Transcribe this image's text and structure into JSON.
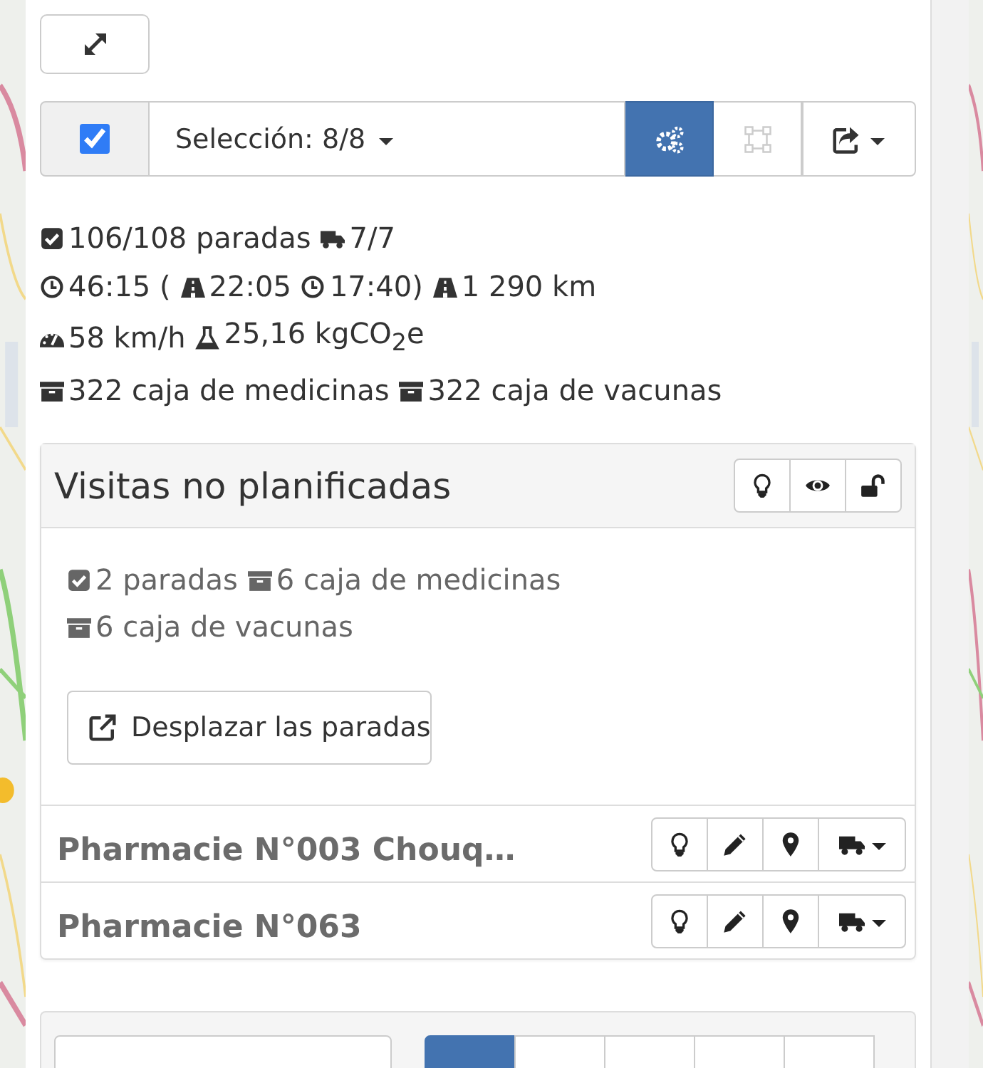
{
  "toolbar": {
    "select_all": {
      "checked": true
    },
    "selection": "Selección: 8/8",
    "buttons": [
      {
        "kind": "optimize",
        "selected": true,
        "disabled": false
      },
      {
        "kind": "shape",
        "selected": false,
        "disabled": true
      },
      {
        "kind": "export",
        "selected": false,
        "disabled": false
      }
    ]
  },
  "summary": [
    [
      {
        "kind": "check",
        "text": "106/108 paradas"
      },
      {
        "kind": "truck",
        "text": "7/7"
      }
    ],
    [
      {
        "kind": "clock",
        "text": "46:15 ("
      },
      {
        "kind": "road",
        "text": "22:05"
      },
      {
        "kind": "clock",
        "text": "17:40)"
      },
      {
        "kind": "road",
        "text": "1 290 km"
      }
    ],
    [
      {
        "kind": "gauge",
        "text": "58 km/h"
      },
      {
        "kind": "flask",
        "text": "25,16 kgCO$_{2}$e"
      }
    ],
    [
      {
        "kind": "box",
        "text": "322 caja de medicinas"
      },
      {
        "kind": "box",
        "text": "322 caja de vacunas"
      }
    ]
  ],
  "unplanned": {
    "title": "Visitas no planificadas",
    "header_buttons": [
      {
        "kind": "bulb"
      },
      {
        "kind": "eye"
      },
      {
        "kind": "unlock"
      }
    ],
    "summary": [
      [
        {
          "kind": "check",
          "text": "2 paradas"
        },
        {
          "kind": "box",
          "text": "6 caja de medicinas"
        }
      ],
      [
        {
          "kind": "box",
          "text": "6 caja de vacunas"
        }
      ]
    ],
    "move_button": "Desplazar las paradas",
    "stops": [
      {
        "name": "Pharmacie N°003 Chouq…"
      },
      {
        "name": "Pharmacie N°063"
      }
    ]
  },
  "bottom_toolbar": {
    "buttons": [
      {
        "selected": true
      },
      {
        "selected": false
      },
      {
        "selected": false
      },
      {
        "selected": false
      },
      {
        "selected": false
      }
    ]
  }
}
